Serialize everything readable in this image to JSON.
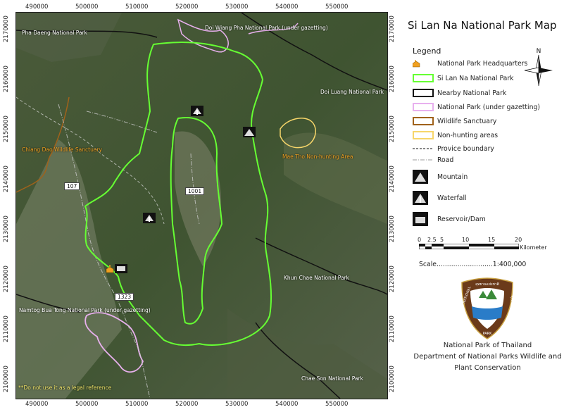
{
  "title": "Si Lan Na National Park Map",
  "coords": {
    "top": [
      "490000",
      "500000",
      "510000",
      "520000",
      "530000",
      "540000",
      "550000"
    ],
    "bottom": [
      "490000",
      "500000",
      "510000",
      "520000",
      "530000",
      "540000",
      "550000"
    ],
    "left": [
      "2170000",
      "2160000",
      "2150000",
      "2140000",
      "2130000",
      "2120000",
      "2110000",
      "2100000"
    ],
    "right": [
      "2170000",
      "2160000",
      "2150000",
      "2140000",
      "2130000",
      "2120000",
      "2110000",
      "2100000"
    ]
  },
  "map_labels": {
    "pha_daeng": "Pha Daeng National Park",
    "doi_wiang_pha": "Doi Wiang Pha National Park (under gazetting)",
    "doi_luang": "Doi Luang National Park",
    "chiang_dao": "Chiang Dao Wildlife Sanctuary",
    "mae_tho": "Mae Tho Non-hunting Area",
    "khun_chae": "Khun Chae National Park",
    "namtog": "Namtog Bua Tong National Park (under gazetting)",
    "chae_son": "Chae Son National Park",
    "disclaimer": "**Do not use it as a legal reference"
  },
  "roads": [
    "107",
    "1001",
    "1323"
  ],
  "legend": {
    "heading": "Legend",
    "items": [
      {
        "label": "National Park Headquarters"
      },
      {
        "label": "Si Lan Na National Park"
      },
      {
        "label": "Nearby National Park"
      },
      {
        "label": "National Park (under gazetting)"
      },
      {
        "label": "Wildlife Sanctuary"
      },
      {
        "label": "Non-hunting areas"
      },
      {
        "label": "Provice boundary"
      },
      {
        "label": "Road"
      },
      {
        "label": "Mountain"
      },
      {
        "label": "Waterfall"
      },
      {
        "label": "Reservoir/Dam"
      }
    ]
  },
  "scale_bar": {
    "ticks": [
      "0",
      "2.5",
      "5",
      "10",
      "15",
      "20"
    ],
    "unit": "Kilometer",
    "scale_text": "Scale...........................1:400,000"
  },
  "north_label": "N",
  "logo_text": {
    "top": "อุทยานแห่งชาติ",
    "left": "NATIONAL",
    "right": "THAILAND",
    "bottom": "PARK"
  },
  "footer": {
    "line1": "National Park of Thailand",
    "line2": "Department of National Parks Wildlife and",
    "line3": "Plant Conservation"
  },
  "colors": {
    "park": "#66ff33",
    "nearby": "#111111",
    "gazetting": "#e8b0ee",
    "wildlife": "#a0621b",
    "nonhunting": "#f7d66a",
    "logo_brown": "#6b3a1a"
  }
}
